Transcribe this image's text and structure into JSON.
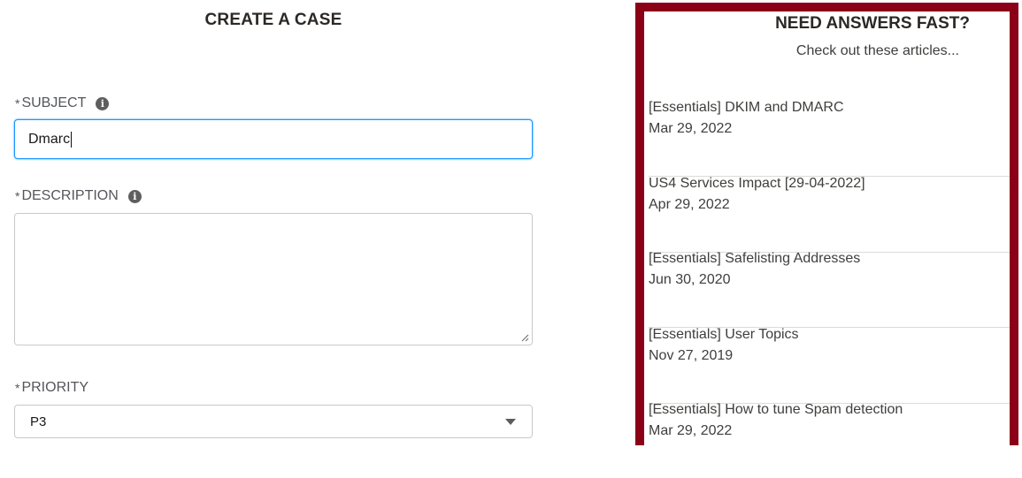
{
  "form": {
    "title": "CREATE A CASE",
    "subject": {
      "label": "SUBJECT",
      "value": "Dmarc"
    },
    "description": {
      "label": "DESCRIPTION",
      "value": ""
    },
    "priority": {
      "label": "PRIORITY",
      "value": "P3"
    },
    "required_marker": "*",
    "info_glyph": "i"
  },
  "sidebar": {
    "title": "NEED ANSWERS FAST?",
    "subtitle": "Check out these articles...",
    "accent_color": "#8b0016",
    "articles": [
      {
        "title": "[Essentials] DKIM and DMARC",
        "date": "Mar 29, 2022"
      },
      {
        "title": "US4 Services Impact [29-04-2022]",
        "date": "Apr 29, 2022"
      },
      {
        "title": "[Essentials] Safelisting Addresses",
        "date": "Jun 30, 2020"
      },
      {
        "title": "[Essentials] User Topics",
        "date": "Nov 27, 2019"
      },
      {
        "title": "[Essentials] How to tune Spam detection",
        "date": "Mar 29, 2022"
      }
    ]
  }
}
